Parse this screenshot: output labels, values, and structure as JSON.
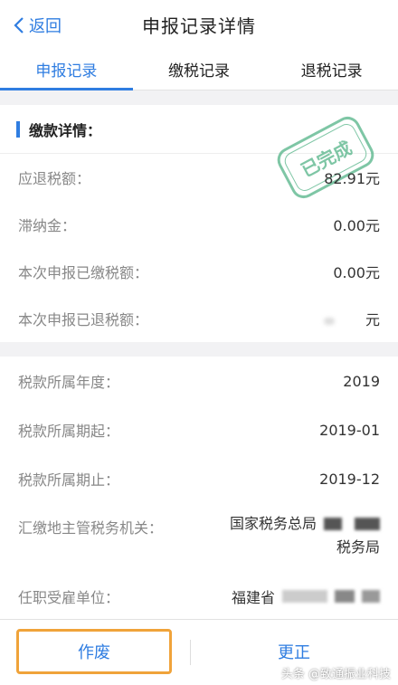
{
  "nav": {
    "back_label": "返回",
    "title": "申报记录详情"
  },
  "tabs": [
    {
      "label": "申报记录",
      "active": true
    },
    {
      "label": "缴税记录",
      "active": false
    },
    {
      "label": "退税记录",
      "active": false
    }
  ],
  "payment": {
    "section_title": "缴款详情：",
    "stamp_text": "已完成",
    "rows": [
      {
        "label": "应退税额：",
        "value": "82.91元"
      },
      {
        "label": "滞纳金：",
        "value": "0.00元"
      },
      {
        "label": "本次申报已缴税额：",
        "value": "0.00元"
      },
      {
        "label": "本次申报已退税额：",
        "value": "元"
      }
    ]
  },
  "details": {
    "rows": [
      {
        "label": "税款所属年度：",
        "value": "2019"
      },
      {
        "label": "税款所属期起：",
        "value": "2019-01"
      },
      {
        "label": "税款所属期止：",
        "value": "2019-12"
      }
    ],
    "authority": {
      "label": "汇缴地主管税务机关：",
      "line1": "国家税务总局",
      "line2": "税务局"
    },
    "employer": {
      "label": "任职受雇单位：",
      "value": "福建省"
    }
  },
  "actions": {
    "void_label": "作废",
    "correct_label": "更正"
  },
  "watermark": "头条 @致通振业科技",
  "colors": {
    "accent": "#2f7de1",
    "highlight": "#f0a33a",
    "stamp": "#5fb88f"
  }
}
